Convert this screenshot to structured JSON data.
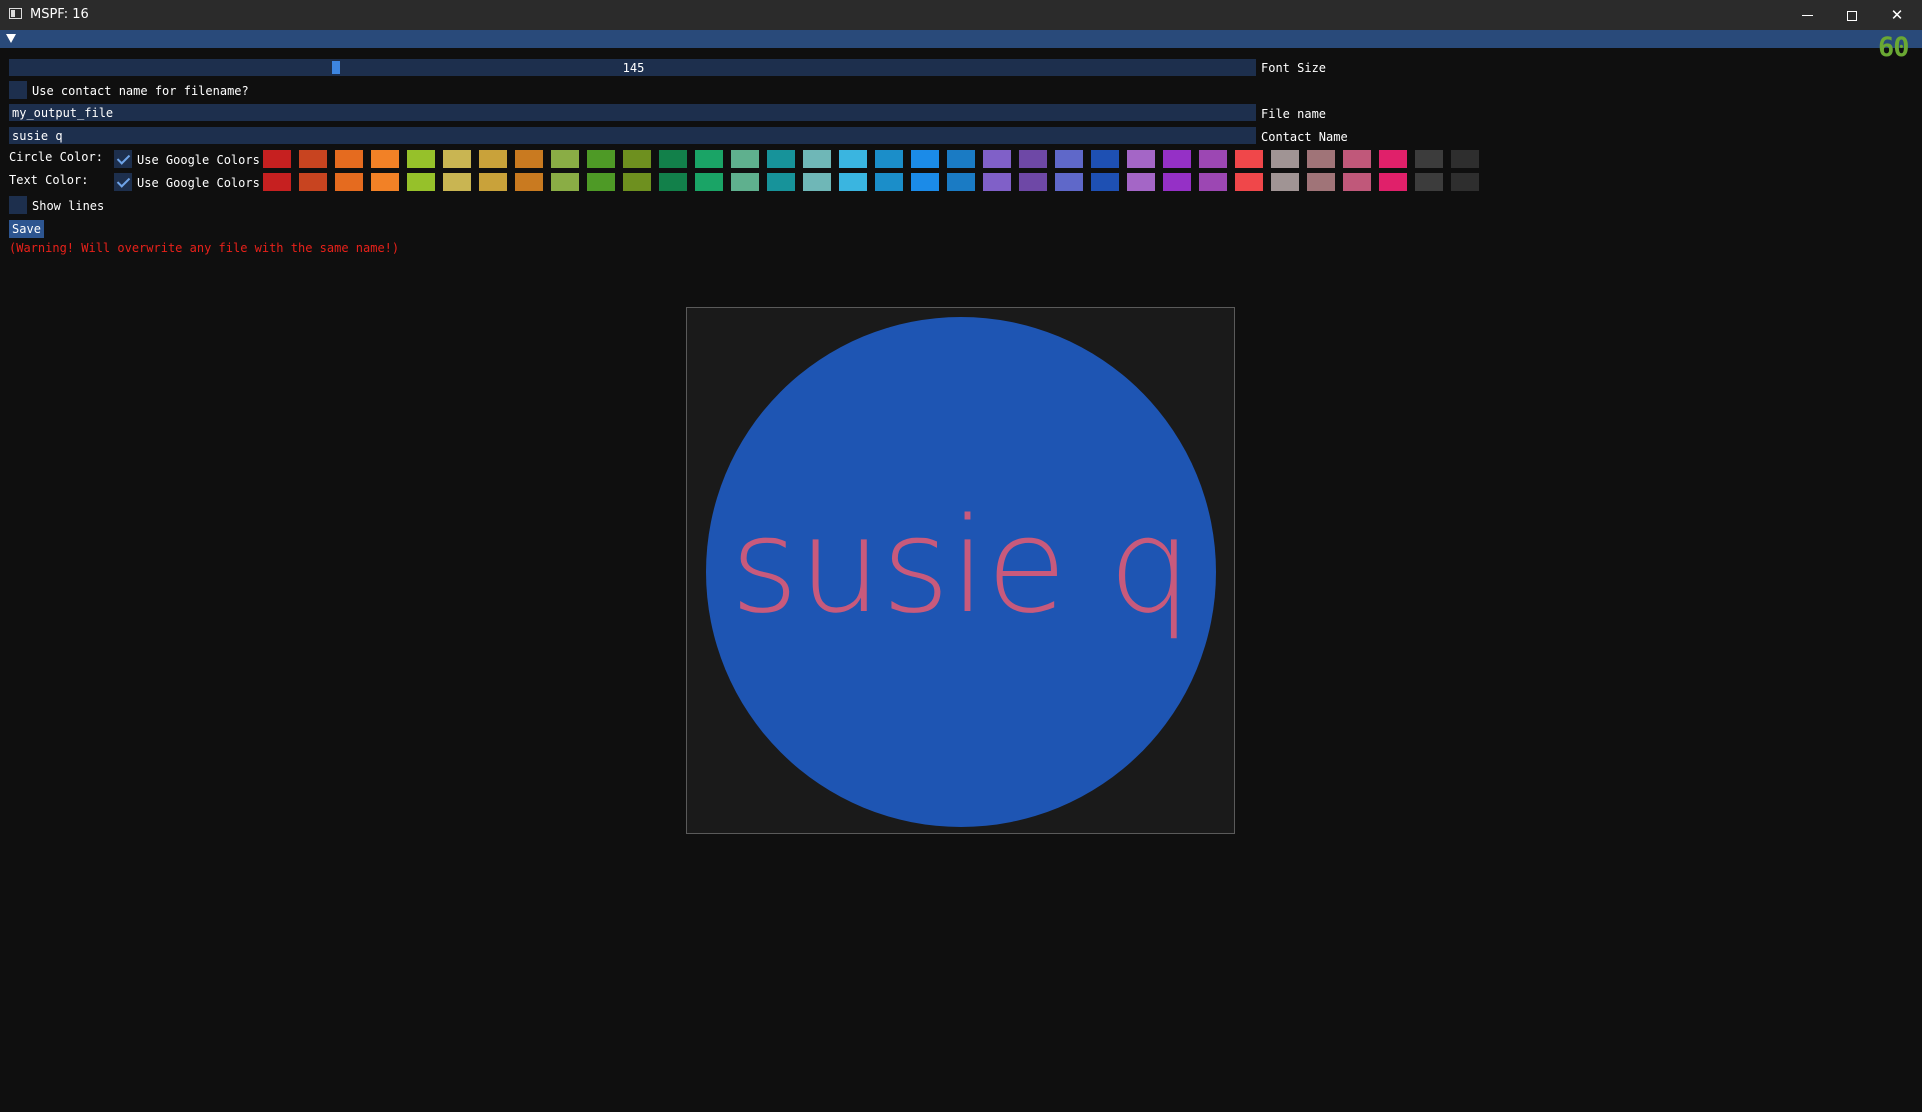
{
  "window": {
    "title": "MSPF: 16",
    "minimize_label": "minimize",
    "maximize_label": "maximize",
    "close_label": "✕"
  },
  "fps_counter": "60",
  "controls": {
    "font_size": {
      "value": "145",
      "label": "Font Size",
      "fraction": 0.261
    },
    "use_contact_name": {
      "label": "Use contact name for filename?",
      "checked": false
    },
    "file_name": {
      "value": "my_output_file",
      "label": "File name"
    },
    "contact_name": {
      "value": "susie q",
      "label": "Contact Name"
    },
    "circle_color": {
      "label": "Circle Color:",
      "google_label": "Use Google Colors",
      "checked": true
    },
    "text_color": {
      "label": "Text Color:",
      "google_label": "Use Google Colors",
      "checked": true
    },
    "show_lines": {
      "label": "Show lines",
      "checked": false
    },
    "save_label": "Save",
    "warning": "(Warning! Will overwrite any file with the same name!)"
  },
  "palette": [
    "#c62020",
    "#c84420",
    "#e56b1f",
    "#f28126",
    "#96c12a",
    "#c9b552",
    "#c9a23a",
    "#c97a20",
    "#8aad45",
    "#4e9a26",
    "#6e901f",
    "#12804a",
    "#1aa466",
    "#5fb08e",
    "#17939a",
    "#6fb7b7",
    "#3ab5e0",
    "#1b8ec9",
    "#1b8be8",
    "#1a7bc4",
    "#8060c8",
    "#6e48a6",
    "#5f68c9",
    "#1e50b3",
    "#a466c6",
    "#9530c6",
    "#9c47b3",
    "#f0474a",
    "#a09494",
    "#a07478",
    "#c0587a",
    "#e0206a",
    "#3c3c3c",
    "#2e2e2e"
  ],
  "preview": {
    "text": "susie q",
    "circle_color": "#1e55b3",
    "text_color": "#c85a7c",
    "background": "#1a1a1a"
  }
}
